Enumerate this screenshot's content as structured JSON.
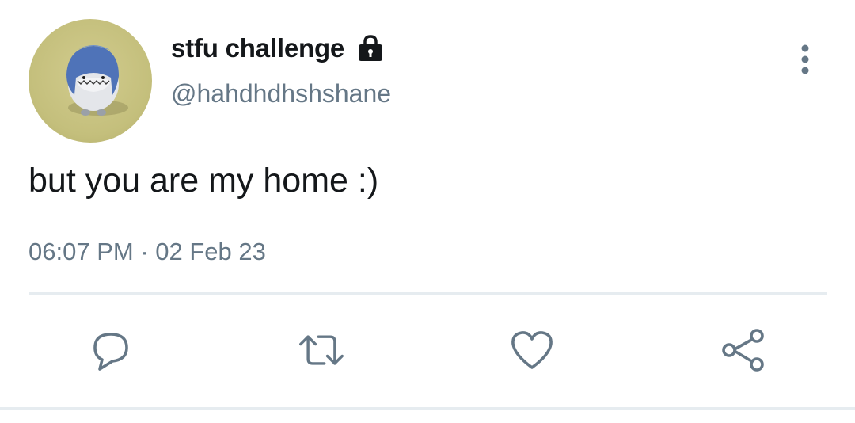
{
  "tweet": {
    "display_name": "stfu challenge",
    "handle": "@hahdhdhshshane",
    "text": "but you are my home :)",
    "time": "06:07 PM",
    "separator": "·",
    "date": "02 Feb 23"
  },
  "icons": {
    "lock": "lock-icon",
    "more": "more-vertical-icon",
    "reply": "reply-icon",
    "retweet": "retweet-icon",
    "like": "heart-icon",
    "share": "share-icon"
  },
  "colors": {
    "text_primary": "#14171a",
    "text_secondary": "#657786",
    "icon": "#657786",
    "divider": "#e6ecf0",
    "background": "#ffffff"
  }
}
